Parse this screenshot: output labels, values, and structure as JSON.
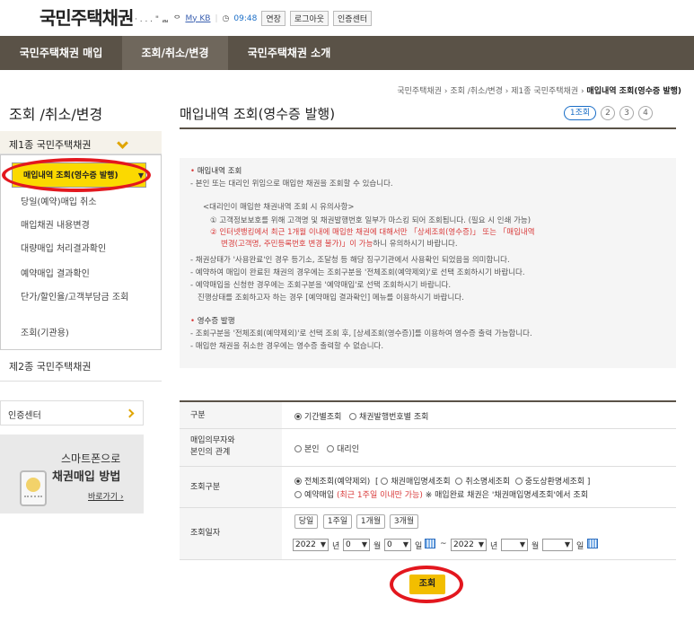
{
  "header": {
    "logo": "국민주택채권",
    "shortcut_text": "· . . . \" ᆲ",
    "my_kb": "My KB",
    "time": "09:48",
    "extend_label": "연장",
    "logout_label": "로그아웃",
    "cert_center_label": "인증센터"
  },
  "gnb": [
    "국민주택채권 매입",
    "조회/취소/변경",
    "국민주택채권 소개"
  ],
  "breadcrumb": [
    "국민주택채권",
    "조회 /취소/변경",
    "제1종 국민주택채권",
    "매입내역 조회(영수증 발행)"
  ],
  "sidebar": {
    "title": "조회 /취소/변경",
    "group1": "제1종 국민주택채권",
    "items": [
      "매입내역 조회(영수증 발행)",
      "당일(예약)매입 취소",
      "매입채권 내용변경",
      "대량매입 처리결과확인",
      "예약매입 결과확인",
      "단가/할인율/고객부담금 조회",
      "조회(기관용)"
    ],
    "group2": "제2종 국민주택채권",
    "cert": "인증센터",
    "banner": {
      "line1": "스마트폰으로",
      "line2": "채권매입 방법",
      "link": "바로가기 ›"
    }
  },
  "main": {
    "title": "매입내역 조회(영수증 발행)",
    "steps": [
      "1조회",
      "2",
      "3",
      "4"
    ],
    "notice": {
      "h1": "매입내역 조회",
      "l1": "- 본인 또는 대리인 위임으로 매입한 채권을 조회할 수 있습니다.",
      "l2": "<대리인이 매입한 채권내역 조회 시 유의사항>",
      "l3": "① 고객정보보호를 위해 고객명 및 채권발행번호 일부가 마스킹 되어 조회됩니다. (필요 시 인쇄 가능)",
      "l4": "② 인터넷뱅킹에서 최근 1개월 이내에 매입한 채권에 대해서만 「상세조회(영수증)」 또는 「매입내역",
      "l5": "변경(고객명, 주민등록번호 변경 불가)」이 가능",
      "l5b": "하니 유의하시기 바랍니다.",
      "l6": "- 채권상태가 '사용완료'인 경우 등기소, 조달청 등 해당 징구기관에서 사용확인 되었음을 의미합니다.",
      "l7": "- 예약하여 매입이 완료된 채권의 경우에는 조회구분을 '전체조회(예약제외)'로 선택 조회하시기 바랍니다.",
      "l8": "- 예약매입을 신청한 경우에는 조회구분을 '예약매입'로 선택 조회하시기 바랍니다.",
      "l9": "진행상태를 조회하고자 하는 경우 [예약매입 결과확인] 메뉴를 이용하시기 바랍니다.",
      "h2": "영수증 발행",
      "l10": "- 조회구분을 '전체조회(예약제외)'로 선택 조회 후, [상세조회(영수증)]를 이용하여 영수증 출력 가능합니다.",
      "l11": "- 매입한 채권을 취소한 경우에는 영수증 출력할 수 없습니다."
    },
    "form": {
      "row1_label": "구분",
      "row1_opt1": "기간별조회",
      "row1_opt2": "채권발행번호별 조회",
      "row2_label1": "매입의무자와",
      "row2_label2": "본인의 관계",
      "row2_opt1": "본인",
      "row2_opt2": "대리인",
      "row3_label": "조회구분",
      "row3_opt1": "전체조회(예약제외)",
      "row3_bracket_open": "[",
      "row3_opt2": "채권매입명세조회",
      "row3_opt3": "취소명세조회",
      "row3_opt4": "중도상환명세조회",
      "row3_bracket_close": "]",
      "row3_opt5": "예약매입",
      "row3_note_red": "(최근 1주일 이내만 가능)",
      "row3_note": "※ 매입완료 채권은 '채권매입명세조회'에서 조회",
      "row4_label": "조회일자",
      "quick": [
        "당일",
        "1주일",
        "1개월",
        "3개월"
      ],
      "from_year": "2022",
      "from_month": "0",
      "from_day": "0",
      "to_year": "2022",
      "to_month": "",
      "to_day": "",
      "unit_year": "년",
      "unit_month": "월",
      "unit_day": "일",
      "tilde": "~"
    },
    "search_label": "조회"
  }
}
